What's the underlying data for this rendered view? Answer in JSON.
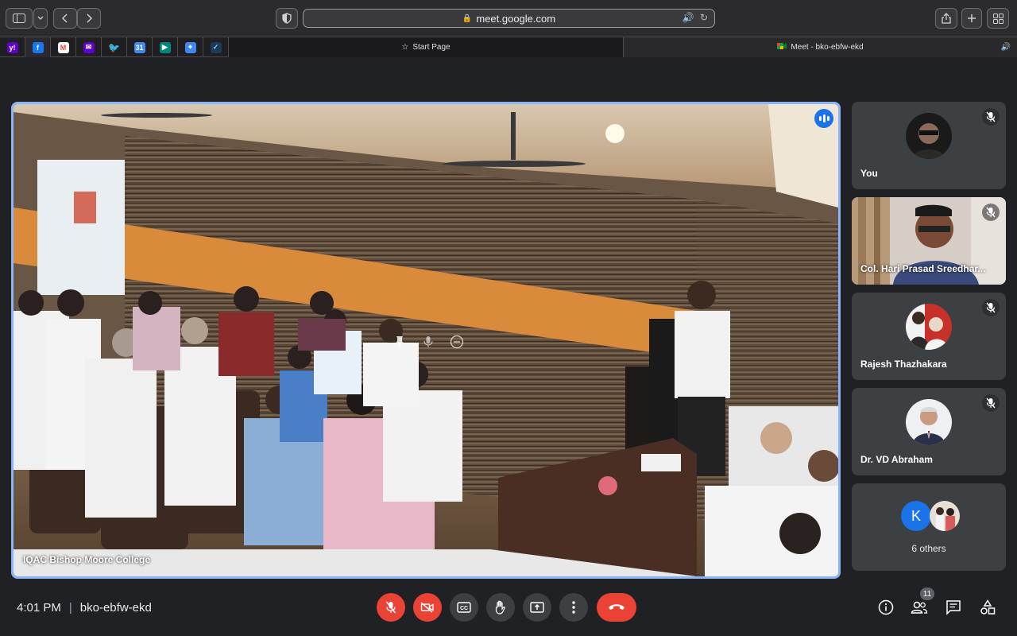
{
  "browser": {
    "url": "meet.google.com",
    "tabs": [
      {
        "label": "Start Page"
      },
      {
        "label": "Meet - bko-ebfw-ekd"
      }
    ],
    "pinned_icons": [
      "yahoo-icon",
      "facebook-icon",
      "gmail-icon",
      "yahoo-mail-icon",
      "twitter-icon",
      "calendar-icon",
      "meet-icon",
      "maps-icon",
      "feedly-icon"
    ]
  },
  "main_tile": {
    "name": "IQAC Bishop Moore College"
  },
  "participants": [
    {
      "name": "You",
      "muted": true
    },
    {
      "name": "Col. Hari Prasad Sreedhar...",
      "muted": true
    },
    {
      "name": "Rajesh Thazhakara",
      "muted": true
    },
    {
      "name": "Dr. VD Abraham",
      "muted": true
    }
  ],
  "others": {
    "initial": "K",
    "label": "6 others"
  },
  "meeting": {
    "time": "4:01 PM",
    "separator": "|",
    "code": "bko-ebfw-ekd",
    "participant_count": "11"
  },
  "colors": {
    "accent": "#8ab4f8",
    "danger": "#ea4335",
    "tile_bg": "#3c4043",
    "page_bg": "#202124"
  }
}
